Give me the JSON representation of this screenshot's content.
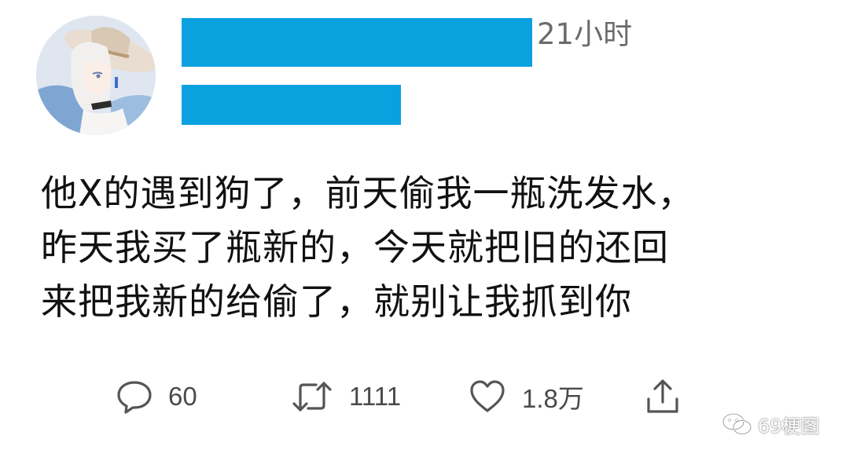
{
  "tweet": {
    "timestamp": "21小时",
    "lines": [
      "他X的遇到狗了，前天偷我一瓶洗发水，",
      "昨天我买了瓶新的，今天就把旧的还回",
      "来把我新的给偷了，就别让我抓到你"
    ]
  },
  "actions": {
    "reply_count": "60",
    "retweet_count": "1111",
    "like_count": "1.8万"
  },
  "watermark": {
    "text": "69梗图"
  },
  "colors": {
    "redaction": "#0aa1df",
    "text": "#111111",
    "muted": "#6b6b6b",
    "icon": "#555555"
  },
  "icons": [
    "reply-icon",
    "retweet-icon",
    "like-icon",
    "share-icon",
    "wechat-icon"
  ]
}
